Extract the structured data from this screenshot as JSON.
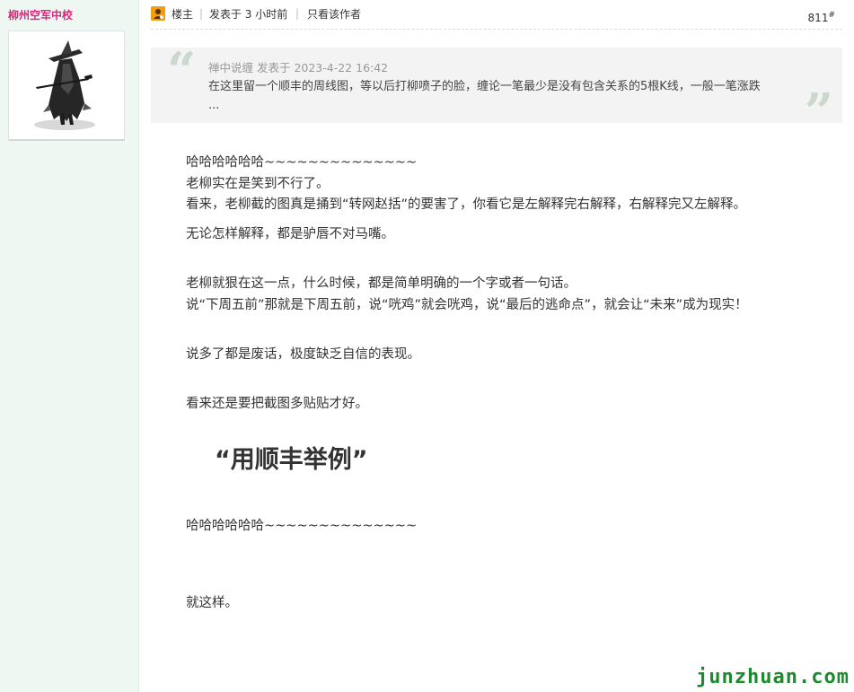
{
  "author": {
    "name": "柳州空军中校",
    "avatar": "ronin-warrior-avatar"
  },
  "post_header": {
    "badge_icon": "op-badge-icon",
    "role": "楼主",
    "posted_time": "发表于 3 小时前",
    "only_author": "只看该作者",
    "floor_number": "811",
    "floor_suffix": "#"
  },
  "quote": {
    "header": "禅中说缠 发表于 2023-4-22 16:42",
    "text": "在这里留一个顺丰的周线图，等以后打柳喷子的脸，缠论一笔最少是没有包含关系的5根K线，一般一笔涨跌 ..."
  },
  "body": {
    "line1": "哈哈哈哈哈哈~~~~~~~~~~~~~~",
    "line2": "老柳实在是笑到不行了。",
    "line3": "看来，老柳截的图真是捅到“转网赵括”的要害了，你看它是左解释完右解释，右解释完又左解释。",
    "line4": "无论怎样解释，都是驴唇不对马嘴。",
    "line5": "老柳就狠在这一点，什么时候，都是简单明确的一个字或者一句话。",
    "line6": "说“下周五前”那就是下周五前，说“咣鸡”就会咣鸡，说“最后的逃命点”，就会让“未来”成为现实！",
    "line7": "说多了都是废话，极度缺乏自信的表现。",
    "line8": "看来还是要把截图多贴贴才好。",
    "highlight": "“用顺丰举例”",
    "line9": "哈哈哈哈哈哈~~~~~~~~~~~~~~",
    "line10": "就这样。"
  },
  "watermark": "junzhuan.com",
  "colors": {
    "sidebar_bg": "#eef7f1",
    "author_name": "#e3237f",
    "quote_bg": "#f3f3f3",
    "quote_mark": "#c9d9cd",
    "watermark": "#1e8a2e",
    "badge": "#f39c12"
  }
}
